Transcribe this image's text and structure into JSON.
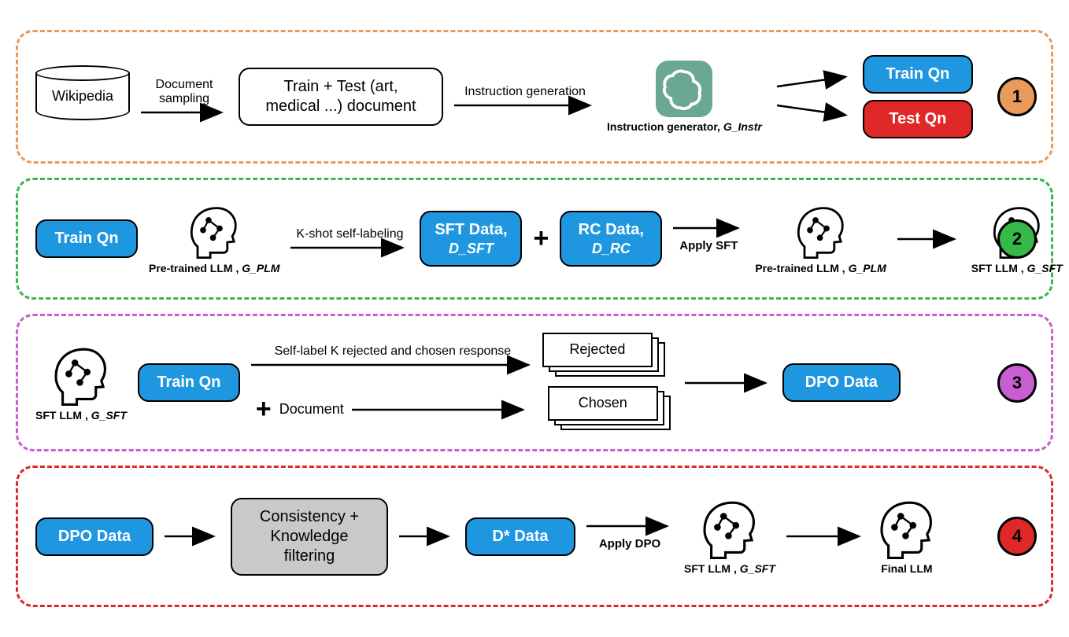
{
  "panel1": {
    "wikipedia": "Wikipedia",
    "doc_sampling": "Document\nsampling",
    "doc_box_l1": "Train + Test (art,",
    "doc_box_l2": "medical ...) document",
    "instr_gen": "Instruction generation",
    "instr_generator_label": "Instruction generator, ",
    "instr_generator_sub": "G_Instr",
    "train_qn": "Train Qn",
    "test_qn": "Test Qn",
    "badge": "1"
  },
  "panel2": {
    "train_qn": "Train Qn",
    "plm_label": "Pre-trained LLM , ",
    "plm_sub": "G_PLM",
    "kshot": "K-shot self-labeling",
    "sft_data_l1": "SFT Data,",
    "sft_data_l2": "D_SFT",
    "rc_data_l1": "RC Data,",
    "rc_data_l2": "D_RC",
    "apply_sft": "Apply SFT",
    "sft_llm_label": "SFT LLM , ",
    "sft_llm_sub": "G_SFT",
    "badge": "2"
  },
  "panel3": {
    "sft_llm_label": "SFT LLM , ",
    "sft_llm_sub": "G_SFT",
    "train_qn": "Train Qn",
    "document": "Document",
    "self_label": "Self-label K rejected and chosen response",
    "rejected": "Rejected",
    "chosen": "Chosen",
    "dpo_data": "DPO Data",
    "badge": "3"
  },
  "panel4": {
    "dpo_data": "DPO Data",
    "filter_l1": "Consistency +",
    "filter_l2": "Knowledge",
    "filter_l3": "filtering",
    "dstar": "D* Data",
    "apply_dpo": "Apply DPO",
    "sft_llm_label": "SFT LLM , ",
    "sft_llm_sub": "G_SFT",
    "final_llm": "Final LLM",
    "badge": "4"
  }
}
